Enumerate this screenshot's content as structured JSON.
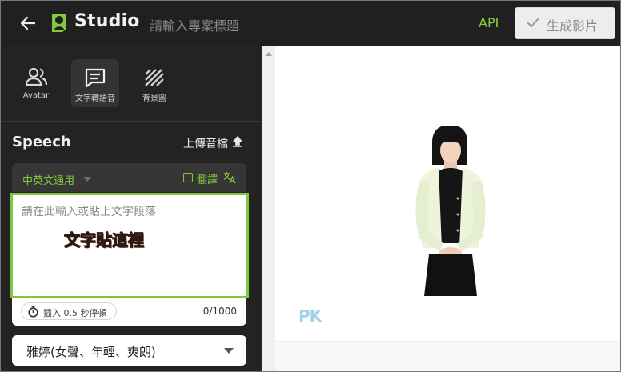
{
  "header": {
    "back_icon": "arrow-left-icon",
    "brand": "Studio",
    "project_placeholder": "請輸入專案標題",
    "api_label": "API",
    "generate_label": "生成影片",
    "accent_color": "#8ccf3c"
  },
  "tabs": [
    {
      "label": "Avatar",
      "icon": "people-icon",
      "active": false
    },
    {
      "label": "文字轉語音",
      "icon": "chat-text-icon",
      "active": true
    },
    {
      "label": "背景圖",
      "icon": "hatch-background-icon",
      "active": false
    }
  ],
  "speech": {
    "title": "Speech",
    "upload_label": "上傳音檔",
    "language": "中英文通用",
    "translate_label": "翻譯",
    "translate_checked": false,
    "text_placeholder": "請在此輸入或貼上文字段落",
    "overlay_note": "文字貼這裡",
    "pause_label": "插入 0.5 秒停頓",
    "char_count": "0/1000",
    "voice": "雅婷(女聲、年輕、爽朗)"
  },
  "preview": {
    "watermark": "PK"
  }
}
